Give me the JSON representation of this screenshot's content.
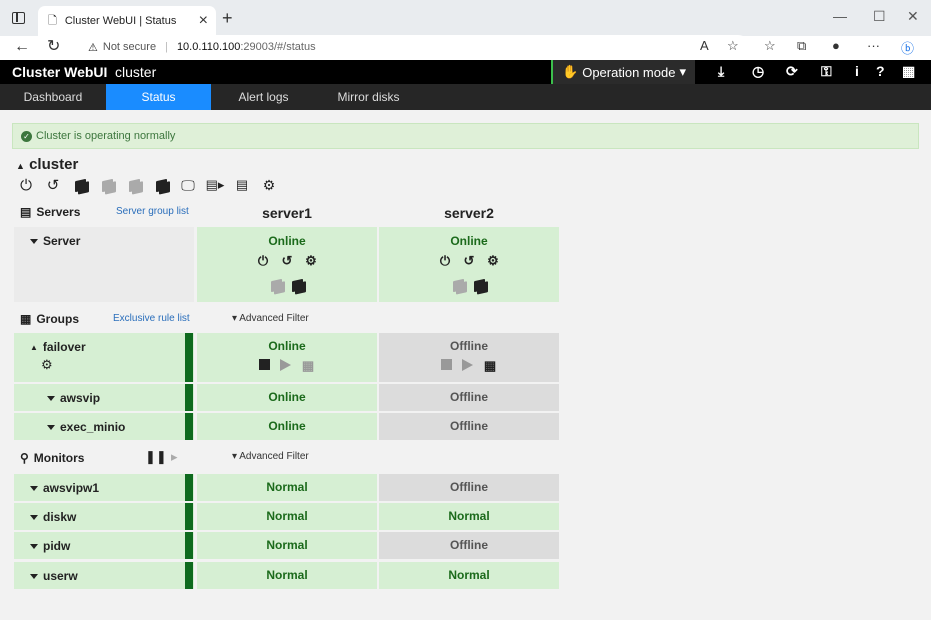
{
  "browser": {
    "tab_title": "Cluster WebUI | Status",
    "security": "Not secure",
    "url_host": "10.0.110.100",
    "url_path": ":29003/#/status"
  },
  "header": {
    "brand": "Cluster WebUI",
    "cluster_name": "cluster",
    "operation_mode": "Operation mode"
  },
  "nav": {
    "tabs": [
      "Dashboard",
      "Status",
      "Alert logs",
      "Mirror disks"
    ],
    "active": "Status"
  },
  "alert": {
    "text": "Cluster is operating normally"
  },
  "cluster": {
    "title": "cluster"
  },
  "servers": {
    "label": "Servers",
    "link": "Server group list",
    "columns": [
      "server1",
      "server2"
    ],
    "row_label": "Server",
    "status": [
      "Online",
      "Online"
    ]
  },
  "groups": {
    "label": "Groups",
    "link": "Exclusive rule list",
    "filter": "Advanced Filter",
    "rows": [
      {
        "name": "failover",
        "status": [
          "Online",
          "Offline"
        ]
      },
      {
        "name": "awsvip",
        "status": [
          "Online",
          "Offline"
        ]
      },
      {
        "name": "exec_minio",
        "status": [
          "Online",
          "Offline"
        ]
      }
    ]
  },
  "monitors": {
    "label": "Monitors",
    "filter": "Advanced Filter",
    "rows": [
      {
        "name": "awsvipw1",
        "status": [
          "Normal",
          "Offline"
        ]
      },
      {
        "name": "diskw",
        "status": [
          "Normal",
          "Normal"
        ]
      },
      {
        "name": "pidw",
        "status": [
          "Normal",
          "Offline"
        ]
      },
      {
        "name": "userw",
        "status": [
          "Normal",
          "Normal"
        ]
      }
    ]
  },
  "colors": {
    "accent": "#1a8cff",
    "online": "#1b6a1b",
    "online_bg": "#d6efd3",
    "offline_bg": "#dcdcdc",
    "status_bar": "#0e6a1e"
  }
}
